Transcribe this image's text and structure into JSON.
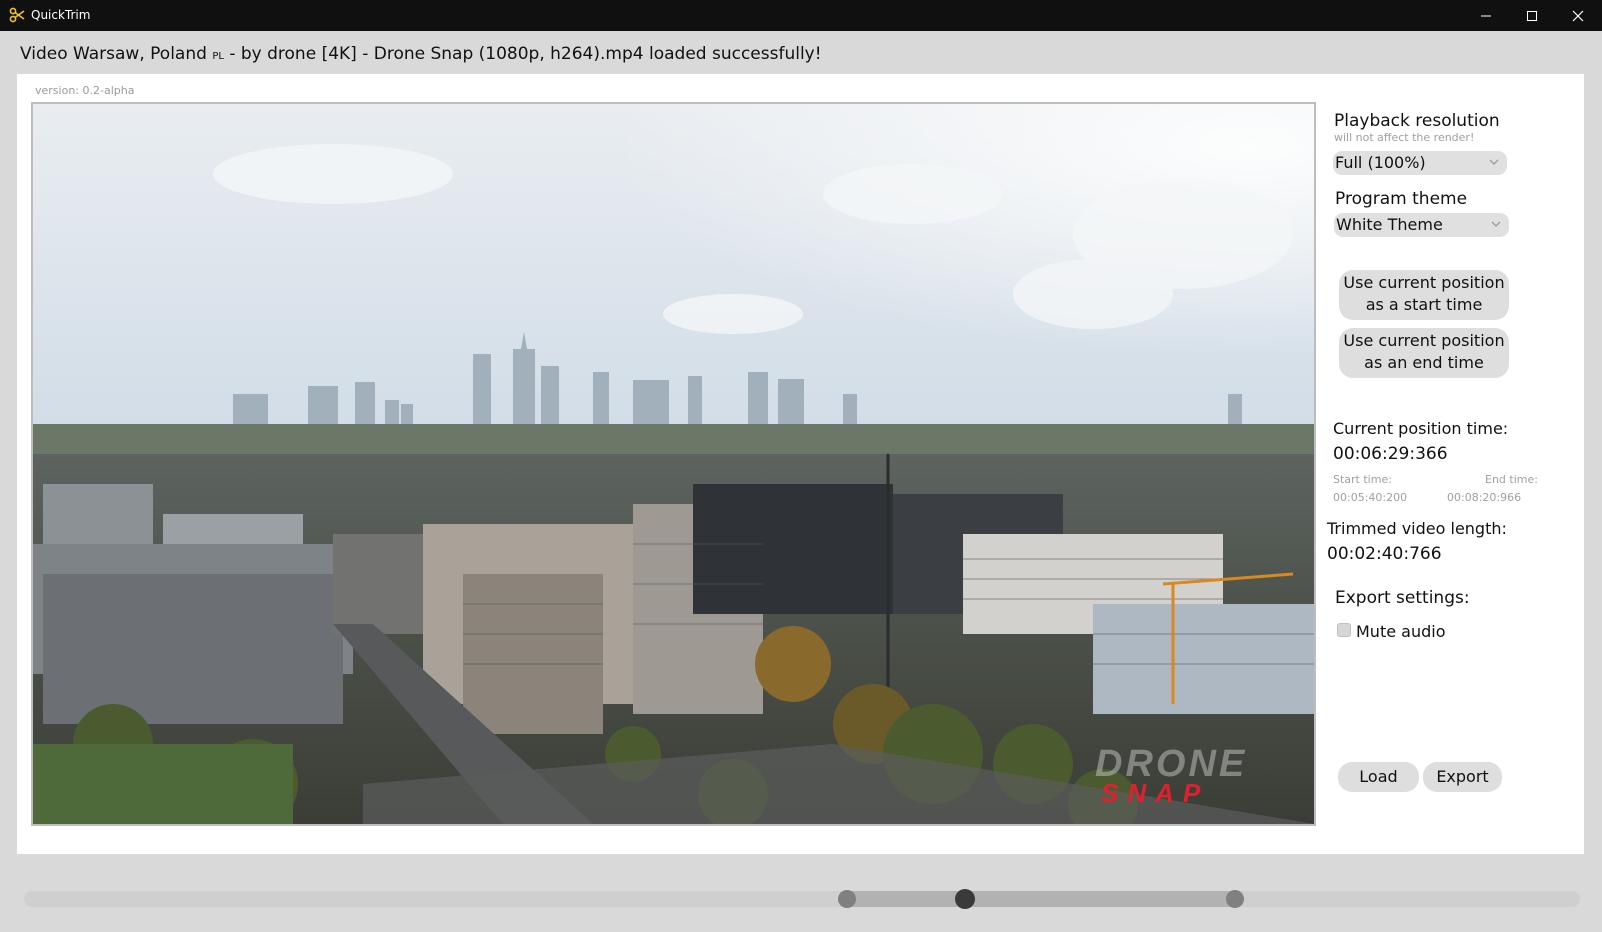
{
  "window": {
    "app_name": "QuickTrim",
    "app_icon": "scissors-icon",
    "controls": [
      "minimize-icon",
      "maximize-icon",
      "close-icon"
    ]
  },
  "status": {
    "prefix": "Video Warsaw, Poland ",
    "flag_letters": "PL",
    "suffix": " - by drone [4K] - Drone Snap (1080p, h264).mp4 loaded successfully!"
  },
  "version_label": "version: 0.2-alpha",
  "video": {
    "description": "aerial drone view of Warsaw city skyline",
    "watermark_logo": "DRONE SNAP"
  },
  "playback": {
    "title": "Playback resolution",
    "hint": "will not affect the render!",
    "selected": "Full (100%)"
  },
  "theme": {
    "title": "Program theme",
    "selected": "White Theme"
  },
  "buttons": {
    "start_line1": "Use current position",
    "start_line2": "as a start time",
    "end_line1": "Use current position",
    "end_line2": "as an end time",
    "load": "Load",
    "export": "Export"
  },
  "position": {
    "title": "Current position time:",
    "value": "00:06:29:366",
    "start_label": "Start time:",
    "start_value": "00:05:40:200",
    "end_label": "End time:",
    "end_value": "00:08:20:966"
  },
  "trimmed": {
    "title": "Trimmed video length:",
    "value": "00:02:40:766"
  },
  "export_settings": {
    "title": "Export settings:",
    "mute_label": "Mute audio",
    "mute_checked": false
  },
  "timeline": {
    "start_fraction": 0.529,
    "position_fraction": 0.605,
    "end_fraction": 0.778
  },
  "colors": {
    "titlebar": "#101010",
    "background": "#d9d9d9",
    "panel": "#ffffff",
    "control": "#dedede",
    "watermark_red": "#e0202c"
  }
}
